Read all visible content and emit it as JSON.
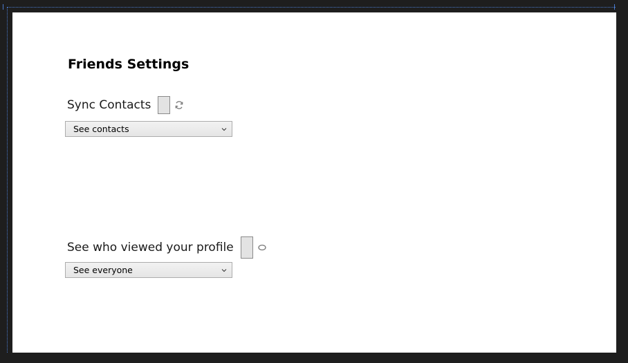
{
  "page": {
    "title": "Friends Settings"
  },
  "settings": [
    {
      "label": "Sync Contacts",
      "status_icon": "refresh-icon",
      "dropdown_value": "See contacts"
    },
    {
      "label": "See who viewed your profile",
      "status_icon": "ellipse-icon",
      "dropdown_value": "See everyone"
    }
  ],
  "colors": {
    "frame_background": "#1e1e1e",
    "canvas_background": "#ffffff",
    "guide_line": "#4a7bd0",
    "toggle_fill": "#e3e3e3",
    "icon_gray": "#777777"
  }
}
